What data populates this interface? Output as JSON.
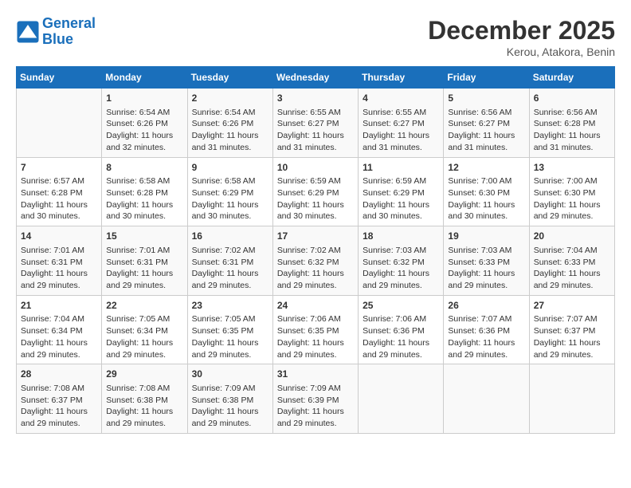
{
  "header": {
    "logo_line1": "General",
    "logo_line2": "Blue",
    "month": "December 2025",
    "location": "Kerou, Atakora, Benin"
  },
  "days_of_week": [
    "Sunday",
    "Monday",
    "Tuesday",
    "Wednesday",
    "Thursday",
    "Friday",
    "Saturday"
  ],
  "weeks": [
    [
      {
        "day": "",
        "info": ""
      },
      {
        "day": "1",
        "info": "Sunrise: 6:54 AM\nSunset: 6:26 PM\nDaylight: 11 hours\nand 32 minutes."
      },
      {
        "day": "2",
        "info": "Sunrise: 6:54 AM\nSunset: 6:26 PM\nDaylight: 11 hours\nand 31 minutes."
      },
      {
        "day": "3",
        "info": "Sunrise: 6:55 AM\nSunset: 6:27 PM\nDaylight: 11 hours\nand 31 minutes."
      },
      {
        "day": "4",
        "info": "Sunrise: 6:55 AM\nSunset: 6:27 PM\nDaylight: 11 hours\nand 31 minutes."
      },
      {
        "day": "5",
        "info": "Sunrise: 6:56 AM\nSunset: 6:27 PM\nDaylight: 11 hours\nand 31 minutes."
      },
      {
        "day": "6",
        "info": "Sunrise: 6:56 AM\nSunset: 6:28 PM\nDaylight: 11 hours\nand 31 minutes."
      }
    ],
    [
      {
        "day": "7",
        "info": "Sunrise: 6:57 AM\nSunset: 6:28 PM\nDaylight: 11 hours\nand 30 minutes."
      },
      {
        "day": "8",
        "info": "Sunrise: 6:58 AM\nSunset: 6:28 PM\nDaylight: 11 hours\nand 30 minutes."
      },
      {
        "day": "9",
        "info": "Sunrise: 6:58 AM\nSunset: 6:29 PM\nDaylight: 11 hours\nand 30 minutes."
      },
      {
        "day": "10",
        "info": "Sunrise: 6:59 AM\nSunset: 6:29 PM\nDaylight: 11 hours\nand 30 minutes."
      },
      {
        "day": "11",
        "info": "Sunrise: 6:59 AM\nSunset: 6:29 PM\nDaylight: 11 hours\nand 30 minutes."
      },
      {
        "day": "12",
        "info": "Sunrise: 7:00 AM\nSunset: 6:30 PM\nDaylight: 11 hours\nand 30 minutes."
      },
      {
        "day": "13",
        "info": "Sunrise: 7:00 AM\nSunset: 6:30 PM\nDaylight: 11 hours\nand 29 minutes."
      }
    ],
    [
      {
        "day": "14",
        "info": "Sunrise: 7:01 AM\nSunset: 6:31 PM\nDaylight: 11 hours\nand 29 minutes."
      },
      {
        "day": "15",
        "info": "Sunrise: 7:01 AM\nSunset: 6:31 PM\nDaylight: 11 hours\nand 29 minutes."
      },
      {
        "day": "16",
        "info": "Sunrise: 7:02 AM\nSunset: 6:31 PM\nDaylight: 11 hours\nand 29 minutes."
      },
      {
        "day": "17",
        "info": "Sunrise: 7:02 AM\nSunset: 6:32 PM\nDaylight: 11 hours\nand 29 minutes."
      },
      {
        "day": "18",
        "info": "Sunrise: 7:03 AM\nSunset: 6:32 PM\nDaylight: 11 hours\nand 29 minutes."
      },
      {
        "day": "19",
        "info": "Sunrise: 7:03 AM\nSunset: 6:33 PM\nDaylight: 11 hours\nand 29 minutes."
      },
      {
        "day": "20",
        "info": "Sunrise: 7:04 AM\nSunset: 6:33 PM\nDaylight: 11 hours\nand 29 minutes."
      }
    ],
    [
      {
        "day": "21",
        "info": "Sunrise: 7:04 AM\nSunset: 6:34 PM\nDaylight: 11 hours\nand 29 minutes."
      },
      {
        "day": "22",
        "info": "Sunrise: 7:05 AM\nSunset: 6:34 PM\nDaylight: 11 hours\nand 29 minutes."
      },
      {
        "day": "23",
        "info": "Sunrise: 7:05 AM\nSunset: 6:35 PM\nDaylight: 11 hours\nand 29 minutes."
      },
      {
        "day": "24",
        "info": "Sunrise: 7:06 AM\nSunset: 6:35 PM\nDaylight: 11 hours\nand 29 minutes."
      },
      {
        "day": "25",
        "info": "Sunrise: 7:06 AM\nSunset: 6:36 PM\nDaylight: 11 hours\nand 29 minutes."
      },
      {
        "day": "26",
        "info": "Sunrise: 7:07 AM\nSunset: 6:36 PM\nDaylight: 11 hours\nand 29 minutes."
      },
      {
        "day": "27",
        "info": "Sunrise: 7:07 AM\nSunset: 6:37 PM\nDaylight: 11 hours\nand 29 minutes."
      }
    ],
    [
      {
        "day": "28",
        "info": "Sunrise: 7:08 AM\nSunset: 6:37 PM\nDaylight: 11 hours\nand 29 minutes."
      },
      {
        "day": "29",
        "info": "Sunrise: 7:08 AM\nSunset: 6:38 PM\nDaylight: 11 hours\nand 29 minutes."
      },
      {
        "day": "30",
        "info": "Sunrise: 7:09 AM\nSunset: 6:38 PM\nDaylight: 11 hours\nand 29 minutes."
      },
      {
        "day": "31",
        "info": "Sunrise: 7:09 AM\nSunset: 6:39 PM\nDaylight: 11 hours\nand 29 minutes."
      },
      {
        "day": "",
        "info": ""
      },
      {
        "day": "",
        "info": ""
      },
      {
        "day": "",
        "info": ""
      }
    ]
  ]
}
